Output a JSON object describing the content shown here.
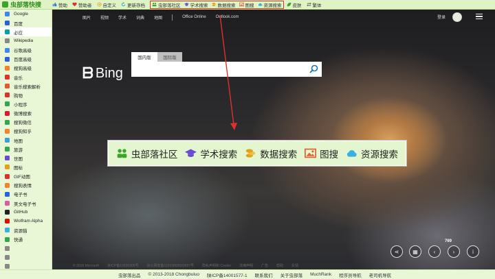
{
  "app": {
    "logo_text": "虫部落快搜"
  },
  "topbar": {
    "links": [
      {
        "label": "赞助",
        "icon": "thumb-icon",
        "color": "#3a7bd5"
      },
      {
        "label": "赞助者",
        "icon": "heart-icon",
        "color": "#e0302a"
      },
      {
        "label": "自定义",
        "icon": "gear-icon",
        "color": "#e0a020"
      },
      {
        "label": "更新存档",
        "icon": "refresh-icon",
        "color": "#3aa0d5"
      }
    ],
    "highlighted": [
      {
        "label": "虫部落社区",
        "icon": "community-icon",
        "color": "#3aa52a"
      },
      {
        "label": "学术搜索",
        "icon": "graduation-cap-icon",
        "color": "#6a4bd5"
      },
      {
        "label": "数据搜索",
        "icon": "coins-icon",
        "color": "#e0a020"
      },
      {
        "label": "图搜",
        "icon": "image-icon",
        "color": "#e0603a"
      },
      {
        "label": "资源搜索",
        "icon": "cloud-icon",
        "color": "#3ab0e0"
      }
    ],
    "extra": [
      {
        "label": "皮肤",
        "icon": "leaf-icon",
        "color": "#3aa52a"
      },
      {
        "label": "繁体",
        "icon": "swap-icon",
        "color": "#555555"
      }
    ]
  },
  "sidebar": {
    "items": [
      {
        "label": "Google",
        "color": "#4285f4"
      },
      {
        "label": "百度",
        "color": "#2d5de0"
      },
      {
        "label": "必应",
        "color": "#00a4a6",
        "active": true
      },
      {
        "label": "Wikipedia",
        "color": "#888888"
      },
      {
        "label": "谷歌高级",
        "color": "#4285f4"
      },
      {
        "label": "百度高级",
        "color": "#2d5de0"
      },
      {
        "label": "搜狗高级",
        "color": "#f5822a"
      },
      {
        "label": "音乐",
        "color": "#e0302a"
      },
      {
        "label": "音乐搜索解析",
        "color": "#e05a2a"
      },
      {
        "label": "购物",
        "color": "#e0302a"
      },
      {
        "label": "小程序",
        "color": "#2fa84f"
      },
      {
        "label": "微博搜索",
        "color": "#e6162d"
      },
      {
        "label": "搜狗微信",
        "color": "#2fa84f"
      },
      {
        "label": "搜狗知乎",
        "color": "#f5822a"
      },
      {
        "label": "地图",
        "color": "#3aa0d5"
      },
      {
        "label": "旅游",
        "color": "#2fa84f"
      },
      {
        "label": "世图",
        "color": "#6a4bd5"
      },
      {
        "label": "图标",
        "color": "#e0a020"
      },
      {
        "label": "GIF动图",
        "color": "#e0302a"
      },
      {
        "label": "搜狗表情",
        "color": "#f5822a"
      },
      {
        "label": "电子书",
        "color": "#2d5de0"
      },
      {
        "label": "美文电子书",
        "color": "#e05aa0"
      },
      {
        "label": "GitHub",
        "color": "#222222"
      },
      {
        "label": "Wolfram Alpha",
        "color": "#dd1100"
      },
      {
        "label": "资源猫",
        "color": "#3ab0e0"
      },
      {
        "label": "快通",
        "color": "#2fa84f"
      },
      {
        "label": "",
        "color": "#888888"
      },
      {
        "label": "",
        "color": "#888888"
      },
      {
        "label": "",
        "color": "#888888"
      },
      {
        "label": "",
        "color": "#888888"
      }
    ]
  },
  "bing": {
    "nav": [
      "图片",
      "视频",
      "学术",
      "词典",
      "地图"
    ],
    "nav2": [
      "Office Online",
      "Outlook.com"
    ],
    "login": "登录",
    "logo": "Bing",
    "tabs": {
      "cn": "国内版",
      "intl": "国际版"
    },
    "search_value": "",
    "count": "769",
    "footer": [
      "© 2018 Microsoft",
      "京ICP备10036305号",
      "京公网安备11010802022657号",
      "隐私声明和 Cookie",
      "法律声明",
      "广告",
      "帮助",
      "反馈"
    ]
  },
  "banner": {
    "items": [
      {
        "label": "虫部落社区",
        "icon": "community-icon"
      },
      {
        "label": "学术搜索",
        "icon": "graduation-cap-icon"
      },
      {
        "label": "数据搜索",
        "icon": "coins-icon"
      },
      {
        "label": "图搜",
        "icon": "image-icon"
      },
      {
        "label": "资源搜索",
        "icon": "cloud-icon"
      }
    ]
  },
  "footer": {
    "links": [
      "虫部落出品",
      "© 2013-2018 Chongbuluo",
      "陕ICP备14001577-1",
      "联系我们",
      "关于虫部落",
      "MuchRank",
      "程序员导航",
      "老司机导航"
    ]
  },
  "colors": {
    "highlight_border": "#e0302a",
    "arrow": "#e0302a",
    "banner_bg": "#e4f6cf"
  }
}
